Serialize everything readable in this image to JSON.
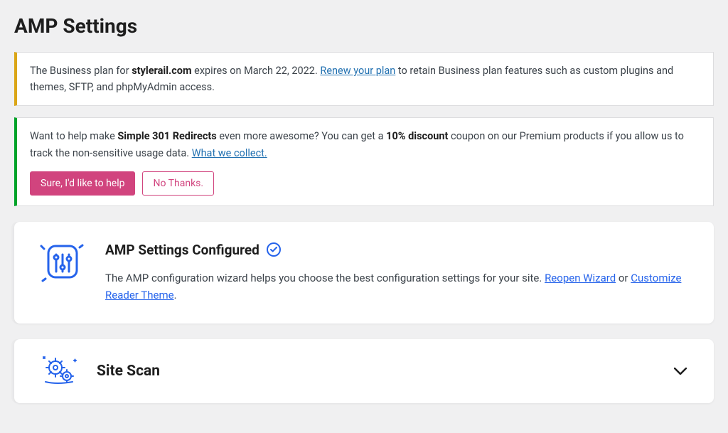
{
  "page": {
    "title": "AMP Settings"
  },
  "notice_plan": {
    "prefix": "The Business plan for ",
    "domain": "stylerail.com",
    "mid": " expires on March 22, 2022. ",
    "link_label": "Renew your plan",
    "suffix": " to retain Business plan features such as custom plugins and themes, SFTP, and phpMyAdmin access."
  },
  "notice_help": {
    "prefix": "Want to help make ",
    "product": "Simple 301 Redirects",
    "mid1": " even more awesome? You can get a ",
    "discount": "10% discount",
    "mid2": " coupon on our Premium products if you allow us to track the non-sensitive usage data. ",
    "link_label": "What we collect.",
    "btn_yes": "Sure, I'd like to help",
    "btn_no": "No Thanks."
  },
  "configured": {
    "title": "AMP Settings Configured",
    "text_prefix": "The AMP configuration wizard helps you choose the best configuration settings for your site. ",
    "link_reopen": "Reopen Wizard",
    "text_or": " or ",
    "link_customize": "Customize Reader Theme",
    "text_suffix": "."
  },
  "site_scan": {
    "title": "Site Scan"
  }
}
